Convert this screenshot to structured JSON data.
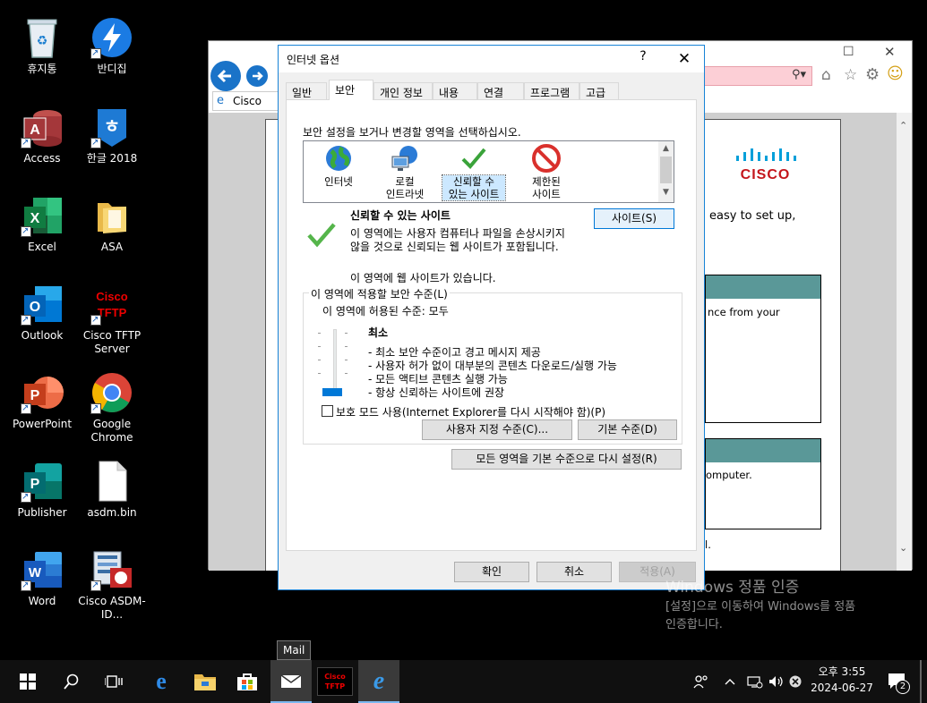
{
  "desktop": {
    "icons": [
      {
        "label": "휴지통"
      },
      {
        "label": "반디집"
      },
      {
        "label": "Access"
      },
      {
        "label": "한글 2018"
      },
      {
        "label": "Excel"
      },
      {
        "label": "ASA"
      },
      {
        "label": "Outlook"
      },
      {
        "label": "Cisco TFTP Server"
      },
      {
        "label": "PowerPoint"
      },
      {
        "label": "Google Chrome"
      },
      {
        "label": "Publisher"
      },
      {
        "label": "asdm.bin"
      },
      {
        "label": "Word"
      },
      {
        "label": "Cisco ASDM-ID..."
      }
    ]
  },
  "ie": {
    "tab_label": "Cisco ASD",
    "page_text_1": "easy to set up,",
    "page_text_2": "nce from your",
    "page_text_3": "omputer.",
    "page_text_4": "l.",
    "cisco_logo": "CISCO"
  },
  "dialog": {
    "title": "인터넷 옵션",
    "help": "?",
    "close": "✕",
    "tabs": [
      "일반",
      "보안",
      "개인 정보",
      "내용",
      "연결",
      "프로그램",
      "고급"
    ],
    "active_tab": "보안",
    "instruction": "보안 설정을 보거나 변경할 영역을 선택하십시오.",
    "zones": [
      {
        "l1": "인터넷",
        "l2": ""
      },
      {
        "l1": "로컬",
        "l2": "인트라넷"
      },
      {
        "l1": "신뢰할 수",
        "l2": "있는 사이트"
      },
      {
        "l1": "제한된",
        "l2": "사이트"
      }
    ],
    "selected_zone_index": 2,
    "zone_heading": "신뢰할 수 있는 사이트",
    "zone_desc_1": "이 영역에는 사용자 컴퓨터나 파일을 손상시키지",
    "zone_desc_2": "않을 것으로 신뢰되는 웹 사이트가 포함됩니다.",
    "zone_sites_note": "이 영역에 웹 사이트가 있습니다.",
    "sites_button": "사이트(S)",
    "group_label": "이 영역에 적용할 보안 수준(L)",
    "allowed_level": "이 영역에 허용된 수준: 모두",
    "level_name": "최소",
    "level_bullets": [
      "- 최소 보안 수준이고 경고 메시지 제공",
      "- 사용자 허가 없이 대부분의 콘텐츠 다운로드/실행 가능",
      "- 모든 액티브 콘텐츠 실행 가능",
      "- 항상 신뢰하는 사이트에 권장"
    ],
    "slider_level": 0,
    "protected_mode": "보호 모드 사용(Internet Explorer를 다시 시작해야 함)(P)",
    "protected_mode_checked": false,
    "custom_level_button": "사용자 지정 수준(C)...",
    "default_level_button": "기본 수준(D)",
    "reset_all_button": "모든 영역을 기본 수준으로 다시 설정(R)",
    "ok_button": "확인",
    "cancel_button": "취소",
    "apply_button": "적용(A)"
  },
  "watermark": {
    "line1": "Windows 정품 인증",
    "line2": "[설정]으로 이동하여 Windows를 정품",
    "line3": "인증합니다."
  },
  "taskbar": {
    "tooltip": "Mail",
    "tftp_label_1": "Cisco",
    "tftp_label_2": "TFTP",
    "time": "오후 3:55",
    "date": "2024-06-27",
    "notification_count": "2"
  }
}
